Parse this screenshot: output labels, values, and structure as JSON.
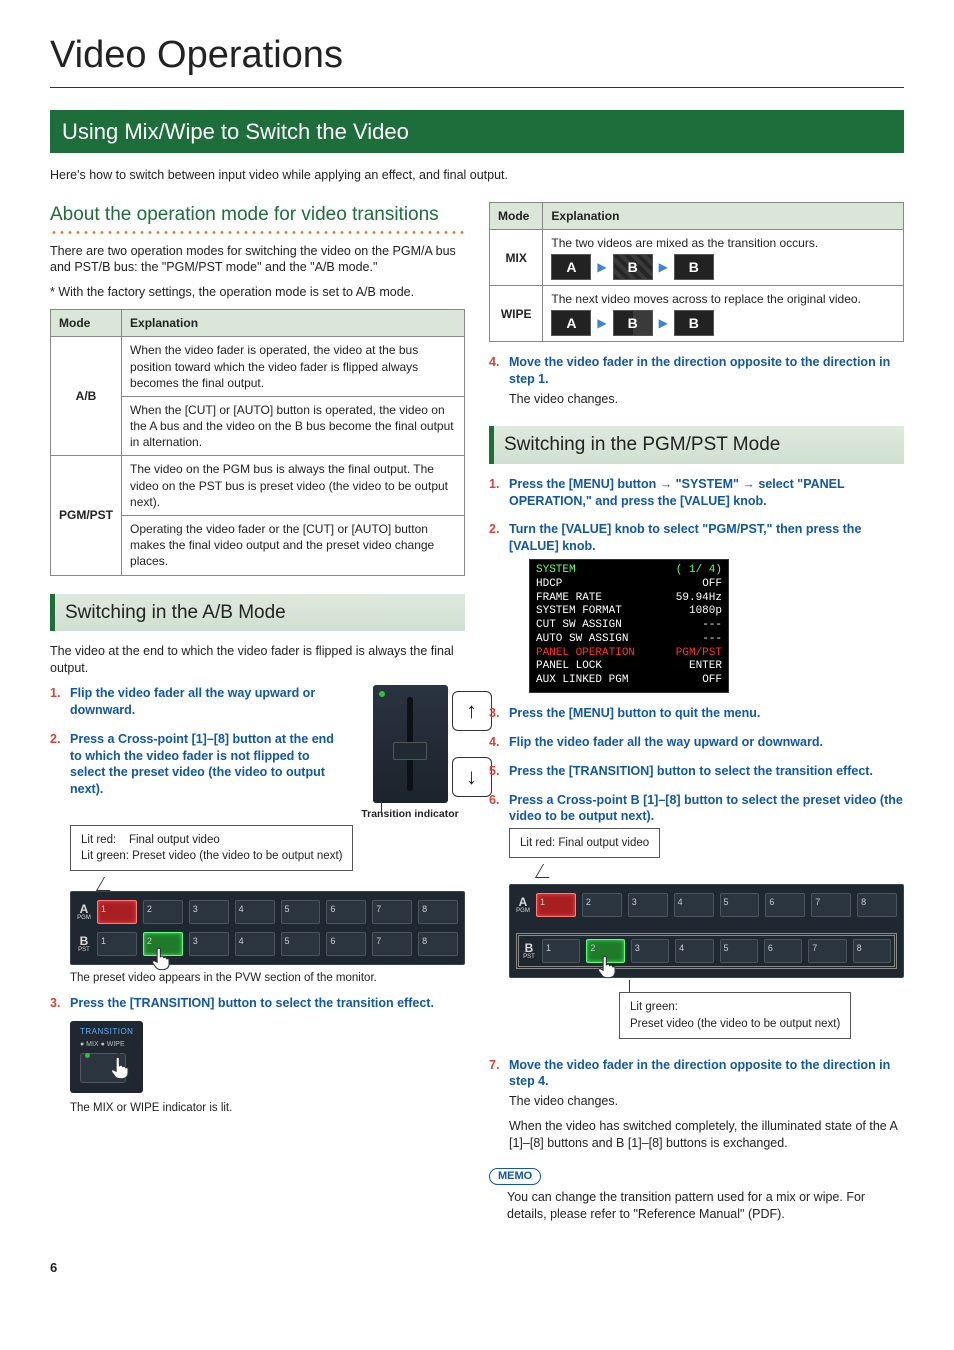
{
  "page_title": "Video Operations",
  "section_title": "Using Mix/Wipe to Switch the Video",
  "intro": "Here's how to switch between input video while applying an effect, and final output.",
  "left": {
    "sub1_title": "About the operation mode for video transitions",
    "sub1_p1": "There are two operation modes for switching the video on the PGM/A bus and PST/B bus: the \"PGM/PST mode\" and the \"A/B mode.\"",
    "sub1_note": "With the factory settings, the operation mode is set to A/B mode.",
    "table1": {
      "h1": "Mode",
      "h2": "Explanation",
      "r1_mode": "A/B",
      "r1a": "When the video fader is operated, the video at the bus position toward which the video fader is flipped always becomes the final output.",
      "r1b": "When the [CUT] or [AUTO] button is operated, the video on the A bus and the video on the B bus become the final output in alternation.",
      "r2_mode": "PGM/PST",
      "r2a": "The video on the PGM bus is always the final output. The video on the PST bus is preset video (the video to be output next).",
      "r2b": "Operating the video fader or the [CUT] or [AUTO] button makes the final video output and the preset video change places."
    },
    "sub2_title": "Switching in the A/B Mode",
    "sub2_p1": "The video at the end to which the video fader is flipped is always the final output.",
    "steps_ab": {
      "s1": "Flip the video fader all the way upward or downward.",
      "s2": "Press a Cross-point [1]–[8] button at the end to which the video fader is not flipped to select the preset video (the video to output next).",
      "fader_caption": "Transition indicator",
      "legend_red": "Lit red:",
      "legend_red_v": "Final output video",
      "legend_green": "Lit green:",
      "legend_green_v": "Preset video (the video to be output next)",
      "rowA_label": "A",
      "rowA_sub": "PGM",
      "rowB_label": "B",
      "rowB_sub": "PST",
      "after_panel": "The preset video appears in the PVW section of the monitor.",
      "s3": "Press the [TRANSITION] button to select the transition effect.",
      "trans_label": "TRANSITION",
      "trans_sub": "● MIX   ● WIPE",
      "after_trans": "The MIX or WIPE indicator is lit."
    }
  },
  "right": {
    "table2": {
      "h1": "Mode",
      "h2": "Explanation",
      "mix": "MIX",
      "mix_text": "The two videos are mixed as the transition occurs.",
      "wipe": "WIPE",
      "wipe_text": "The next video moves across to replace the original video."
    },
    "s4": "Move the video fader in the direction opposite to the direction in step 1.",
    "s4_body": "The video changes.",
    "sub_title": "Switching in the PGM/PST Mode",
    "steps_pgm": {
      "s1a": "Press the [MENU] button ",
      "s1b": " \"SYSTEM\" ",
      "s1c": " select \"PANEL OPERATION,\" and press the [VALUE] knob.",
      "s2": "Turn the [VALUE] knob to select \"PGM/PST,\" then press the [VALUE] knob.",
      "s3": "Press the [MENU] button to quit the menu.",
      "s4": "Flip the video fader all the way upward or downward.",
      "s5": "Press the [TRANSITION] button to select the transition effect.",
      "s6": "Press a Cross-point B [1]–[8] button to select the preset video (the video to be output next).",
      "legend_red": "Lit red: Final output video",
      "legend_green_a": "Lit green:",
      "legend_green_b": "Preset video (the video to be output next)",
      "s7": "Move the video fader in the direction opposite to the direction in step 4.",
      "s7_body1": "The video changes.",
      "s7_body2": "When the video has switched completely, the illuminated state of the A [1]–[8] buttons and B [1]–[8] buttons is exchanged."
    },
    "menu": {
      "title": "SYSTEM",
      "page": "( 1/ 4)",
      "rows": [
        {
          "l": "HDCP",
          "r": "OFF"
        },
        {
          "l": "FRAME RATE",
          "r": "59.94Hz"
        },
        {
          "l": "SYSTEM FORMAT",
          "r": "1080p"
        },
        {
          "l": "CUT SW ASSIGN",
          "r": "---"
        },
        {
          "l": "AUTO SW ASSIGN",
          "r": "---"
        },
        {
          "l": "PANEL OPERATION",
          "r": "PGM/PST",
          "hl": true
        },
        {
          "l": "PANEL LOCK",
          "r": "ENTER"
        },
        {
          "l": "AUX LINKED PGM",
          "r": "OFF"
        }
      ]
    },
    "memo_label": "MEMO",
    "memo_text": "You can change the transition pattern used for a mix or wipe. For details, please refer to \"Reference Manual\" (PDF)."
  },
  "btn_labels": [
    "1",
    "2",
    "3",
    "4",
    "5",
    "6",
    "7",
    "8"
  ],
  "mix_letters": {
    "a": "A",
    "b": "B"
  },
  "page_number": "6"
}
